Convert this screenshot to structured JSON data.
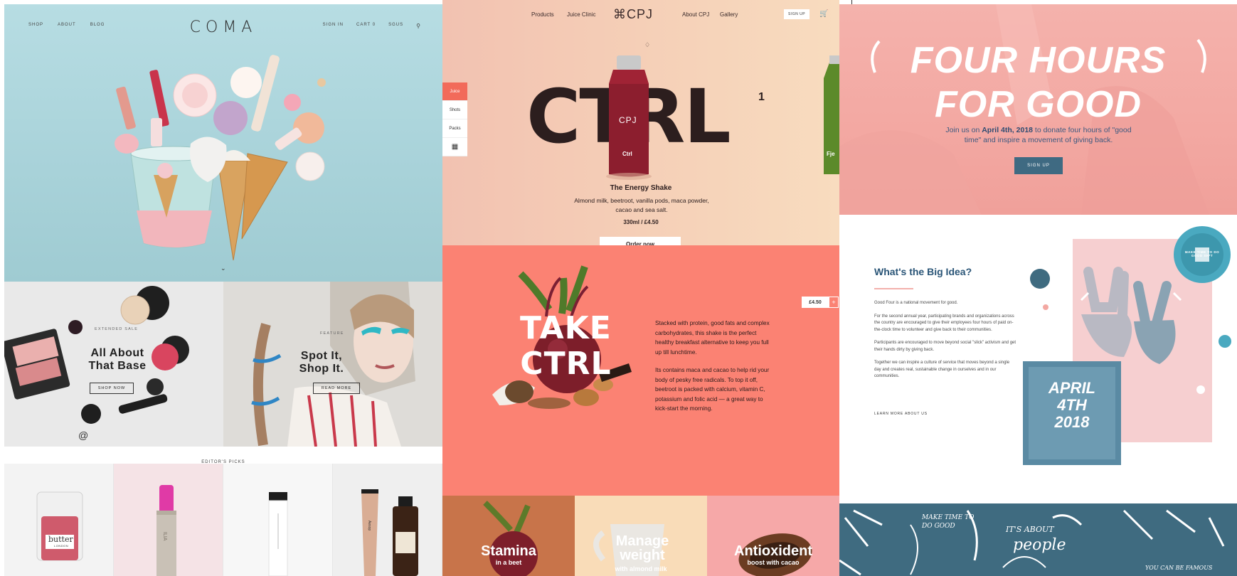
{
  "coma": {
    "nav_left": [
      "SHOP",
      "ABOUT",
      "BLOG"
    ],
    "logo": "COMA",
    "nav_right": [
      "SIGN IN",
      "CART 0",
      "SGUS"
    ],
    "search_icon": "search-icon",
    "sale": {
      "label": "EXTENDED SALE",
      "title_line1": "All About",
      "title_line2": "That Base",
      "button": "SHOP NOW"
    },
    "feature": {
      "label": "FEATURE",
      "title_line1": "Spot It,",
      "title_line2": "Shop It.",
      "button": "READ MORE"
    },
    "at_symbol": "@",
    "picks_header": "EDITOR'S PICKS",
    "picks": [
      {
        "name": "butter",
        "sub": "LONDON"
      },
      {
        "name": "ILIA"
      },
      {
        "name": ""
      },
      {
        "name": "Aesop"
      }
    ],
    "colors": {
      "hero_bg": "#a8d2d9",
      "pink_ice": "#f2b2b8"
    }
  },
  "cpj": {
    "nav": [
      "Products",
      "Juice Clinic",
      "About CPJ",
      "Gallery"
    ],
    "logo": "⌘CPJ",
    "sign_up": "SIGN UP",
    "side": [
      "Juice",
      "Shots",
      "Packs",
      "grid"
    ],
    "hero_word": "CTRL",
    "hero_sup": "1",
    "bottle_brand": "CPJ",
    "bottle_label": "Ctrl",
    "bottle2_label": "Fje",
    "product_title": "The Energy Shake",
    "product_desc": "Almond milk, beetroot, vanilla pods, maca powder, cacao and sea salt.",
    "product_price": "330ml / £4.50",
    "order_button": "Order now",
    "take_line1": "TAKE",
    "take_line2": "CTRL",
    "price_tag": "£4.50",
    "plus": "+",
    "body_p1": "Stacked with protein, good fats and complex carbohydrates, this shake is the perfect healthy breakfast alternative to keep you full up till lunchtime.",
    "body_p2": "Its contains maca and cacao to help rid your body of pesky free radicals. To top it off, beetroot is packed with calcium, vitamin C, potassium and folic acid — a great way to kick-start the morning.",
    "tiles": [
      {
        "title": "Stamina",
        "sub": "in a beet",
        "bg": "#c8744a"
      },
      {
        "title": "Manage weight",
        "sub": "with almond milk",
        "bg": "#f9dcb8"
      },
      {
        "title": "Antioxident",
        "sub": "boost with cacao",
        "bg": "#f6a8a8"
      }
    ],
    "colors": {
      "coral": "#fb8273",
      "dark": "#2c1e1e"
    }
  },
  "goodfour": {
    "title_line1": "FOUR HOURS",
    "title_line2": "FOR GOOD",
    "sub_pre": "Join us on ",
    "sub_date": "April 4th, 2018",
    "sub_post": " to donate four hours of \"good time\" and inspire a movement of giving back.",
    "signup": "SIGN UP",
    "heading": "What's the Big Idea?",
    "p1": "Good Four is a national movement for good.",
    "p2": "For the second annual year, participating brands and organizations across the country are encouraged to give their employees four hours of paid on-the-clock time to volunteer and give back to their communities.",
    "p3": "Participants are encouraged to move beyond social \"slick\" activism and get their hands dirty by giving back.",
    "p4": "Together we can inspire a culture of service that moves beyond a single day and creates real, sustainable change in ourselves and in our communities.",
    "more": "LEARN MORE ABOUT US",
    "badge": "MAKE TIME TO DO GOOD SH*T",
    "poster_line1": "APRIL",
    "poster_line2": "4TH",
    "poster_line3": "2018",
    "script1": "MAKE TIME TO DO GOOD",
    "script2": "IT'S ABOUT",
    "script3": "people",
    "script4": "YOU CAN BE FAMOUS",
    "colors": {
      "pink": "#f3a8a2",
      "navy": "#3f6b80",
      "teal": "#4aa9c0"
    }
  }
}
